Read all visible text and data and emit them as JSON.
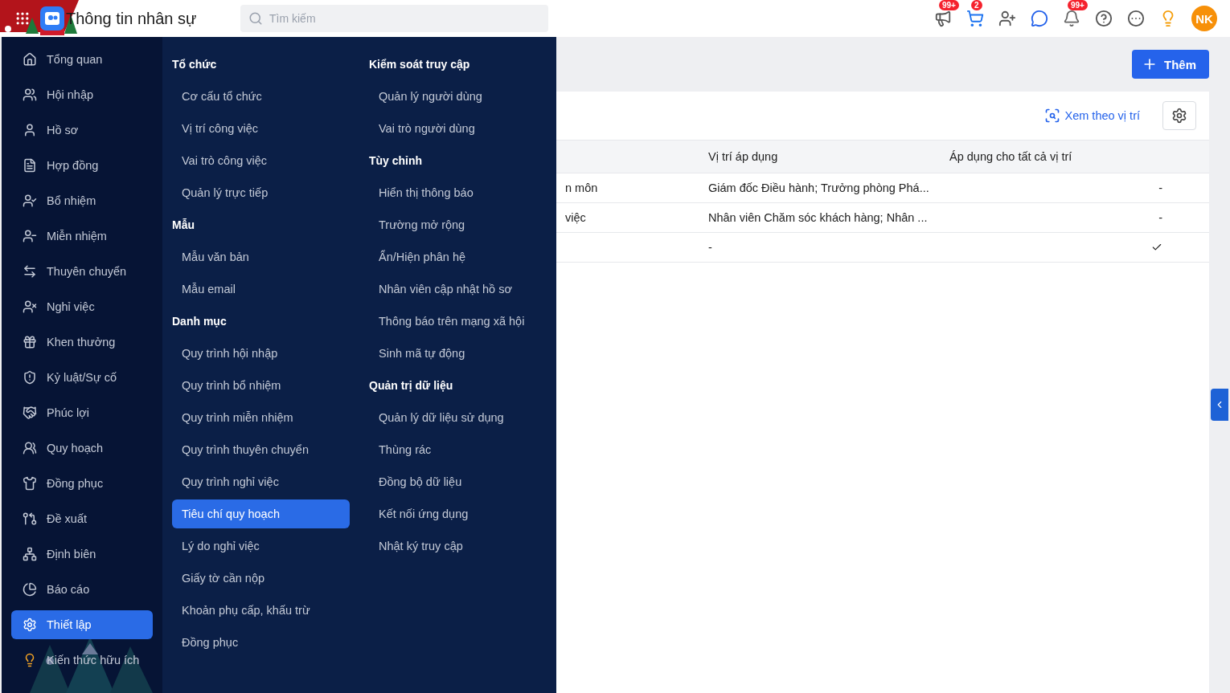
{
  "header": {
    "title": "Thông tin nhân sự",
    "search": {
      "placeholder": "Tìm kiếm"
    },
    "actions": [
      {
        "kind": "announcements",
        "badge": "99+"
      },
      {
        "kind": "cart",
        "badge": "2"
      },
      {
        "kind": "add-user"
      },
      {
        "kind": "chat"
      },
      {
        "kind": "notifications",
        "badge": "99+"
      },
      {
        "kind": "help"
      },
      {
        "kind": "more"
      },
      {
        "kind": "tips"
      }
    ],
    "avatar": {
      "initials": "NK"
    }
  },
  "sidebar": {
    "items": [
      {
        "label": "Tổng quan",
        "selected": false
      },
      {
        "label": "Hội nhập",
        "selected": false
      },
      {
        "label": "Hồ sơ",
        "selected": false
      },
      {
        "label": "Hợp đồng",
        "selected": false
      },
      {
        "label": "Bổ nhiệm",
        "selected": false
      },
      {
        "label": "Miễn nhiệm",
        "selected": false
      },
      {
        "label": "Thuyên chuyển",
        "selected": false
      },
      {
        "label": "Nghỉ việc",
        "selected": false
      },
      {
        "label": "Khen thưởng",
        "selected": false
      },
      {
        "label": "Kỷ luật/Sự cố",
        "selected": false
      },
      {
        "label": "Phúc lợi",
        "selected": false
      },
      {
        "label": "Quy hoạch",
        "selected": false
      },
      {
        "label": "Đồng phục",
        "selected": false
      },
      {
        "label": "Đề xuất",
        "selected": false
      },
      {
        "label": "Định biên",
        "selected": false
      },
      {
        "label": "Báo cáo",
        "selected": false
      },
      {
        "label": "Thiết lập",
        "selected": true
      },
      {
        "label": "Kiến thức hữu ích",
        "selected": false
      }
    ]
  },
  "menu": {
    "columns": [
      {
        "groups": [
          {
            "title": "Tổ chức",
            "items": [
              {
                "label": "Cơ cấu tổ chức",
                "selected": false
              },
              {
                "label": "Vị trí công việc",
                "selected": false
              },
              {
                "label": "Vai trò công việc",
                "selected": false
              },
              {
                "label": "Quản lý trực tiếp",
                "selected": false
              }
            ]
          },
          {
            "title": "Mẫu",
            "items": [
              {
                "label": "Mẫu văn bản",
                "selected": false
              },
              {
                "label": "Mẫu email",
                "selected": false
              }
            ]
          },
          {
            "title": "Danh mục",
            "items": [
              {
                "label": "Quy trình hội nhập",
                "selected": false
              },
              {
                "label": "Quy trình bổ nhiệm",
                "selected": false
              },
              {
                "label": "Quy trình miễn nhiệm",
                "selected": false
              },
              {
                "label": "Quy trình thuyên chuyển",
                "selected": false
              },
              {
                "label": "Quy trình nghỉ việc",
                "selected": false
              },
              {
                "label": "Tiêu chí quy hoạch",
                "selected": true
              },
              {
                "label": "Lý do nghỉ việc",
                "selected": false
              },
              {
                "label": "Giấy tờ cần nộp",
                "selected": false
              },
              {
                "label": "Khoản phụ cấp, khấu trừ",
                "selected": false
              },
              {
                "label": "Đồng phục",
                "selected": false
              }
            ]
          }
        ]
      },
      {
        "groups": [
          {
            "title": "Kiểm soát truy cập",
            "items": [
              {
                "label": "Quản lý người dùng",
                "selected": false
              },
              {
                "label": "Vai trò người dùng",
                "selected": false
              }
            ]
          },
          {
            "title": "Tùy chỉnh",
            "items": [
              {
                "label": "Hiển thị thông báo",
                "selected": false
              },
              {
                "label": "Trường mở rộng",
                "selected": false
              },
              {
                "label": "Ẩn/Hiện phân hệ",
                "selected": false
              },
              {
                "label": "Nhân viên cập nhật hồ sơ",
                "selected": false
              },
              {
                "label": "Thông báo trên mạng xã hội",
                "selected": false
              },
              {
                "label": "Sinh mã tự động",
                "selected": false
              }
            ]
          },
          {
            "title": "Quản trị dữ liệu",
            "items": [
              {
                "label": "Quản lý dữ liệu sử dụng",
                "selected": false
              },
              {
                "label": "Thùng rác",
                "selected": false
              },
              {
                "label": "Đồng bộ dữ liệu",
                "selected": false
              },
              {
                "label": "Kết nối ứng dụng",
                "selected": false
              },
              {
                "label": "Nhật ký truy cập",
                "selected": false
              }
            ]
          }
        ]
      }
    ]
  },
  "toolbar": {
    "add_button": "Thêm",
    "view_link": "Xem theo vị trí"
  },
  "table": {
    "columns": [
      "Vị trí áp dụng",
      "Áp dụng cho tất cả vị trí"
    ],
    "rows": [
      {
        "column_1": "n môn",
        "position": "Giám đốc Điều hành; Trưởng phòng Phá...",
        "all_positions": "-",
        "checked": false
      },
      {
        "column_1": "việc",
        "position": "Nhân viên Chăm sóc khách hàng; Nhân ...",
        "all_positions": "-",
        "checked": false
      },
      {
        "position": "-",
        "checked": true
      }
    ]
  }
}
